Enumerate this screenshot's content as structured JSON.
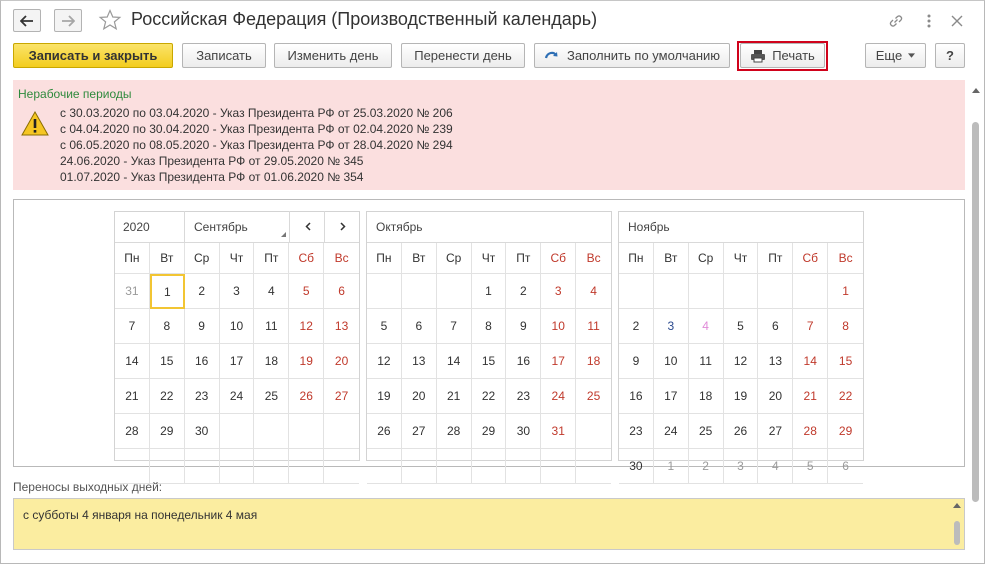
{
  "window": {
    "title": "Российская Федерация (Производственный календарь)"
  },
  "toolbar": {
    "save_close": "Записать и закрыть",
    "save": "Записать",
    "change_day": "Изменить день",
    "move_day": "Перенести день",
    "fill_default": "Заполнить по умолчанию",
    "print": "Печать",
    "more": "Еще",
    "help": "?"
  },
  "warning": {
    "title": "Нерабочие периоды",
    "lines": [
      "с 30.03.2020 по 03.04.2020 - Указ Президента РФ от 25.03.2020 № 206",
      "с 04.04.2020 по 30.04.2020 - Указ Президента РФ от 02.04.2020 № 239",
      "с 06.05.2020 по 08.05.2020 - Указ Президента РФ от 28.04.2020 № 294",
      "24.06.2020 - Указ Президента РФ от 29.05.2020 № 345",
      "01.07.2020 - Указ Президента РФ от 01.06.2020 № 354"
    ]
  },
  "calendar": {
    "year": "2020",
    "selected_month": "Сентябрь",
    "weekdays": [
      "Пн",
      "Вт",
      "Ср",
      "Чт",
      "Пт",
      "Сб",
      "Вс"
    ],
    "months": [
      {
        "name": "Сентябрь",
        "weeks": [
          [
            {
              "d": "31",
              "t": "out"
            },
            {
              "d": "1",
              "t": "sel"
            },
            {
              "d": "2"
            },
            {
              "d": "3"
            },
            {
              "d": "4"
            },
            {
              "d": "5",
              "t": "we"
            },
            {
              "d": "6",
              "t": "we"
            }
          ],
          [
            {
              "d": "7"
            },
            {
              "d": "8"
            },
            {
              "d": "9"
            },
            {
              "d": "10"
            },
            {
              "d": "11"
            },
            {
              "d": "12",
              "t": "we"
            },
            {
              "d": "13",
              "t": "we"
            }
          ],
          [
            {
              "d": "14"
            },
            {
              "d": "15"
            },
            {
              "d": "16"
            },
            {
              "d": "17"
            },
            {
              "d": "18"
            },
            {
              "d": "19",
              "t": "we"
            },
            {
              "d": "20",
              "t": "we"
            }
          ],
          [
            {
              "d": "21"
            },
            {
              "d": "22"
            },
            {
              "d": "23"
            },
            {
              "d": "24"
            },
            {
              "d": "25"
            },
            {
              "d": "26",
              "t": "we"
            },
            {
              "d": "27",
              "t": "we"
            }
          ],
          [
            {
              "d": "28"
            },
            {
              "d": "29"
            },
            {
              "d": "30"
            },
            {
              "d": ""
            },
            {
              "d": ""
            },
            {
              "d": ""
            },
            {
              "d": ""
            }
          ],
          [
            {
              "d": ""
            },
            {
              "d": ""
            },
            {
              "d": ""
            },
            {
              "d": ""
            },
            {
              "d": ""
            },
            {
              "d": ""
            },
            {
              "d": ""
            }
          ]
        ]
      },
      {
        "name": "Октябрь",
        "weeks": [
          [
            {
              "d": ""
            },
            {
              "d": ""
            },
            {
              "d": ""
            },
            {
              "d": "1"
            },
            {
              "d": "2"
            },
            {
              "d": "3",
              "t": "we"
            },
            {
              "d": "4",
              "t": "we"
            }
          ],
          [
            {
              "d": "5"
            },
            {
              "d": "6"
            },
            {
              "d": "7"
            },
            {
              "d": "8"
            },
            {
              "d": "9"
            },
            {
              "d": "10",
              "t": "we"
            },
            {
              "d": "11",
              "t": "we"
            }
          ],
          [
            {
              "d": "12"
            },
            {
              "d": "13"
            },
            {
              "d": "14"
            },
            {
              "d": "15"
            },
            {
              "d": "16"
            },
            {
              "d": "17",
              "t": "we"
            },
            {
              "d": "18",
              "t": "we"
            }
          ],
          [
            {
              "d": "19"
            },
            {
              "d": "20"
            },
            {
              "d": "21"
            },
            {
              "d": "22"
            },
            {
              "d": "23"
            },
            {
              "d": "24",
              "t": "we"
            },
            {
              "d": "25",
              "t": "we"
            }
          ],
          [
            {
              "d": "26"
            },
            {
              "d": "27"
            },
            {
              "d": "28"
            },
            {
              "d": "29"
            },
            {
              "d": "30"
            },
            {
              "d": "31",
              "t": "we"
            },
            {
              "d": ""
            }
          ],
          [
            {
              "d": ""
            },
            {
              "d": ""
            },
            {
              "d": ""
            },
            {
              "d": ""
            },
            {
              "d": ""
            },
            {
              "d": ""
            },
            {
              "d": ""
            }
          ]
        ]
      },
      {
        "name": "Ноябрь",
        "weeks": [
          [
            {
              "d": ""
            },
            {
              "d": ""
            },
            {
              "d": ""
            },
            {
              "d": ""
            },
            {
              "d": ""
            },
            {
              "d": ""
            },
            {
              "d": "1",
              "t": "we"
            }
          ],
          [
            {
              "d": "2"
            },
            {
              "d": "3",
              "t": "blue"
            },
            {
              "d": "4",
              "t": "pink"
            },
            {
              "d": "5"
            },
            {
              "d": "6"
            },
            {
              "d": "7",
              "t": "we"
            },
            {
              "d": "8",
              "t": "we"
            }
          ],
          [
            {
              "d": "9"
            },
            {
              "d": "10"
            },
            {
              "d": "11"
            },
            {
              "d": "12"
            },
            {
              "d": "13"
            },
            {
              "d": "14",
              "t": "we"
            },
            {
              "d": "15",
              "t": "we"
            }
          ],
          [
            {
              "d": "16"
            },
            {
              "d": "17"
            },
            {
              "d": "18"
            },
            {
              "d": "19"
            },
            {
              "d": "20"
            },
            {
              "d": "21",
              "t": "we"
            },
            {
              "d": "22",
              "t": "we"
            }
          ],
          [
            {
              "d": "23"
            },
            {
              "d": "24"
            },
            {
              "d": "25"
            },
            {
              "d": "26"
            },
            {
              "d": "27"
            },
            {
              "d": "28",
              "t": "we"
            },
            {
              "d": "29",
              "t": "we"
            }
          ],
          [
            {
              "d": "30"
            },
            {
              "d": "1",
              "t": "out"
            },
            {
              "d": "2",
              "t": "out"
            },
            {
              "d": "3",
              "t": "out"
            },
            {
              "d": "4",
              "t": "out"
            },
            {
              "d": "5",
              "t": "out"
            },
            {
              "d": "6",
              "t": "out"
            }
          ]
        ]
      }
    ]
  },
  "transfers": {
    "label": "Переносы выходных дней:",
    "text": "с субботы 4 января на понедельник 4 мая"
  },
  "colors": {
    "weekend": "#c0392b",
    "primary_button": "#f3cd1e",
    "warning_bg": "#fbdfdf",
    "transfers_bg": "#fbeda0",
    "print_highlight": "#d0021b"
  }
}
